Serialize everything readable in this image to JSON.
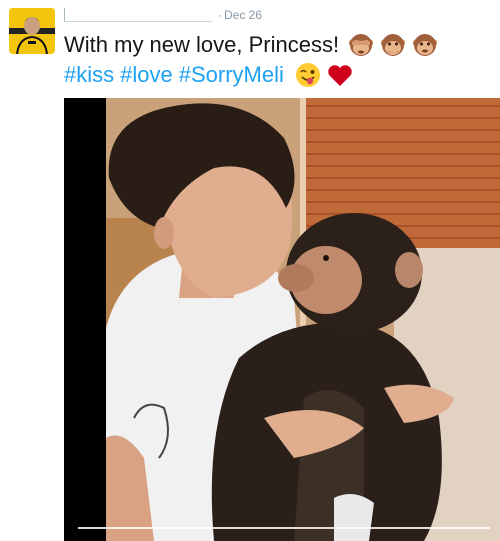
{
  "tweet": {
    "date_separator": "·",
    "date": "Dec 26",
    "text_line1": "With my new love, Princess!",
    "hashtags": [
      "#kiss",
      "#love",
      "#SorryMeli"
    ],
    "line1_emojis": [
      "see-no-evil-monkey-icon",
      "see-no-evil-monkey-icon",
      "see-no-evil-monkey-icon"
    ],
    "line2_emojis": [
      "winking-face-tongue-icon",
      "red-heart-icon"
    ]
  },
  "media": {
    "type": "video",
    "progress": 0.0
  },
  "colors": {
    "hashtag": "#1da1f2",
    "meta": "#8899a6",
    "text": "#14171a"
  }
}
